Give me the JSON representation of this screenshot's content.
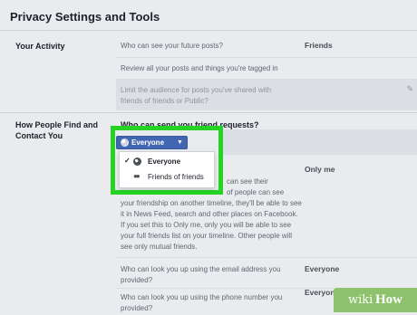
{
  "header": {
    "title": "Privacy Settings and Tools"
  },
  "activity": {
    "label": "Your Activity",
    "q1": "Who can see your future posts?",
    "q1_value": "Friends",
    "q2": "Review all your posts and things you're tagged in",
    "q3_line1": "Limit the audience for posts you've shared with",
    "q3_line2": "friends of friends or Public?"
  },
  "contact": {
    "label_line1": "How People Find and",
    "label_line2": "Contact You",
    "q1": "Who can send you friend requests?",
    "selector_label": "Everyone",
    "options": [
      {
        "label": "Everyone",
        "selected": true,
        "icon": "globe-icon"
      },
      {
        "label": "Friends of friends",
        "selected": false,
        "icon": "people-icon"
      }
    ],
    "friend_list_value": "Only me",
    "friend_list_desc": [
      "can see their",
      "of people can see",
      "your friendship on another timeline, they'll be able to see",
      "it in News Feed, search and other places on Facebook.",
      "If you set this to Only me, only you will be able to see",
      "your full friends list on your timeline. Other people will",
      "see only mutual friends."
    ],
    "email_q_line1": "Who can look you up using the email address you",
    "email_q_line2": "provided?",
    "email_value": "Everyone",
    "phone_q_line1": "Who can look you up using the phone number you",
    "phone_q_line2": "provided?",
    "phone_value": "Everyone"
  },
  "watermark": {
    "part1": "wiki",
    "part2": "How"
  },
  "colors": {
    "highlight": "#24d323",
    "button": "#4267b2",
    "watermark": "#8ec16b"
  }
}
